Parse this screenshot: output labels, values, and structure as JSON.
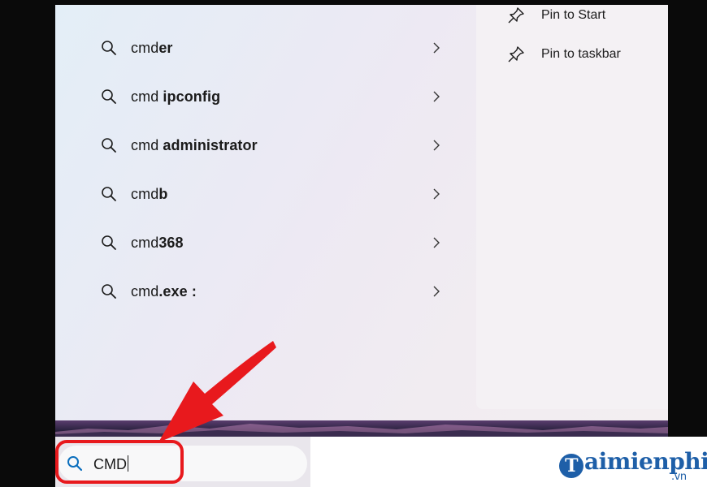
{
  "suggestions": [
    {
      "prefix": "cmd",
      "suffix": "er"
    },
    {
      "prefix": "cmd ",
      "suffix": "ipconfig"
    },
    {
      "prefix": "cmd ",
      "suffix": "administrator"
    },
    {
      "prefix": "cmd",
      "suffix": "b"
    },
    {
      "prefix": "cmd",
      "suffix": "368"
    },
    {
      "prefix": "cmd",
      "suffix": ".exe :"
    }
  ],
  "actions": {
    "pin_start": "Pin to Start",
    "pin_taskbar": "Pin to taskbar"
  },
  "search": {
    "value": "CMD"
  },
  "watermark": {
    "initial": "T",
    "text": "aimienphi",
    "domain": ".vn"
  },
  "colors": {
    "highlight": "#e8191d",
    "search_icon": "#0a6ebd",
    "brand": "#1e5fa8"
  }
}
